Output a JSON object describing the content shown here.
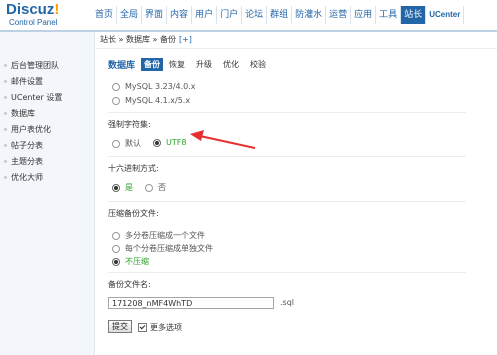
{
  "logo": {
    "main": "Discuz",
    "bang": "!",
    "sub": "Control Panel"
  },
  "nav": [
    "首页",
    "全局",
    "界面",
    "内容",
    "用户",
    "门户",
    "论坛",
    "群组",
    "防灌水",
    "运营",
    "应用",
    "工具",
    "站长",
    "UCenter"
  ],
  "sidebar": [
    "后台管理团队",
    "邮件设置",
    "UCenter 设置",
    "数据库",
    "用户表优化",
    "帖子分表",
    "主题分表",
    "优化大师"
  ],
  "breadcrumb": {
    "text": "站长 » 数据库 » 备份",
    "plus": "[+]"
  },
  "tabs": {
    "title": "数据库",
    "items": [
      "备份",
      "恢复",
      "升级",
      "优化",
      "校验"
    ]
  },
  "mysql": [
    "MySQL 3.23/4.0.x",
    "MySQL 4.1.x/5.x"
  ],
  "charset": {
    "label": "强制字符集:",
    "options": [
      "默认",
      "UTF8"
    ]
  },
  "hex": {
    "label": "十六进制方式:",
    "options": [
      "是",
      "否"
    ]
  },
  "compress": {
    "label": "压缩备份文件:",
    "options": [
      "多分卷压缩成一个文件",
      "每个分卷压缩成单独文件",
      "不压缩"
    ]
  },
  "filename": {
    "label": "备份文件名:",
    "value": "171208_nMF4WhTD",
    "ext": ".sql"
  },
  "submit": "提交",
  "more": "更多选项",
  "colors": {
    "accent": "#2366a8",
    "arrow": "#e53030",
    "green": "#2aa12a"
  }
}
